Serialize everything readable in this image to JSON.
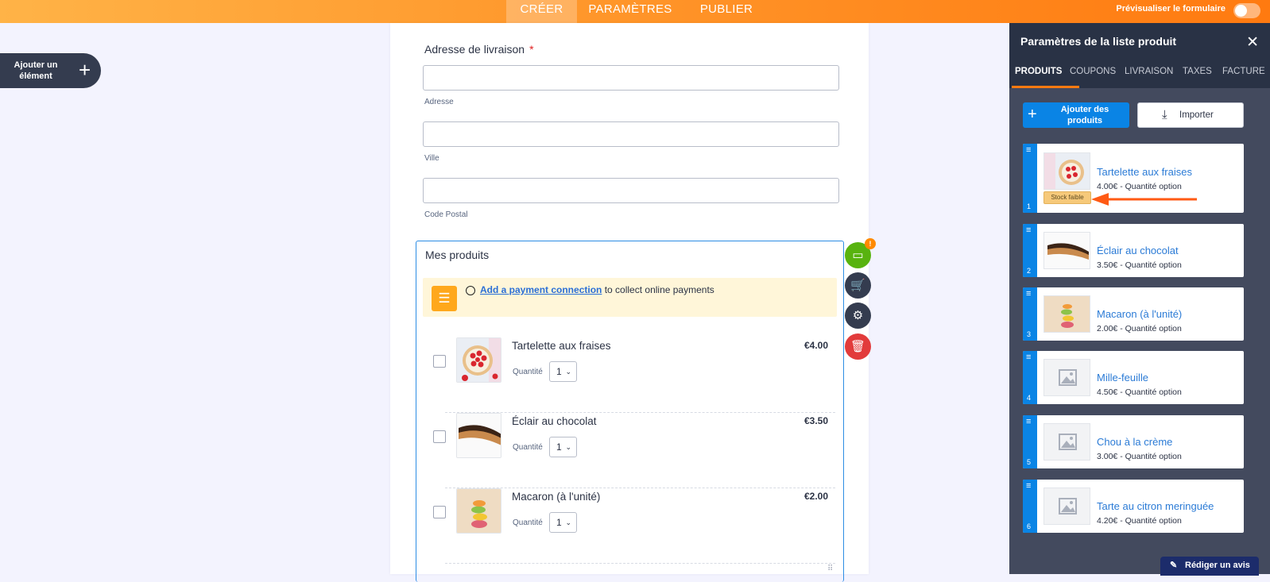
{
  "topbar": {
    "tabs": [
      {
        "label": "CRÉER",
        "active": true
      },
      {
        "label": "PARAMÈTRES",
        "active": false
      },
      {
        "label": "PUBLIER",
        "active": false
      }
    ],
    "preview_label": "Prévisualiser le formulaire"
  },
  "add_element": {
    "label": "Ajouter un élément"
  },
  "form": {
    "address_label": "Adresse de livraison",
    "required_mark": "*",
    "sub_address": "Adresse",
    "sub_city": "Ville",
    "sub_zip": "Code Postal",
    "products_title": "Mes produits",
    "payment_link": "Add a payment connection",
    "payment_text": "to collect online payments",
    "qty_label": "Quantité",
    "products": [
      {
        "name": "Tartelette aux fraises",
        "price": "€4.00",
        "qty": "1"
      },
      {
        "name": "Éclair au chocolat",
        "price": "€3.50",
        "qty": "1"
      },
      {
        "name": "Macaron (à l'unité)",
        "price": "€2.00",
        "qty": "1"
      }
    ]
  },
  "side_tools": {
    "badge": "!"
  },
  "panel": {
    "title": "Paramètres de la liste produit",
    "tabs": [
      {
        "label": "PRODUITS",
        "active": true
      },
      {
        "label": "COUPONS",
        "active": false
      },
      {
        "label": "LIVRAISON",
        "active": false
      },
      {
        "label": "TAXES",
        "active": false
      },
      {
        "label": "FACTURE",
        "active": false
      }
    ],
    "add_products": "Ajouter des produits",
    "import": "Importer",
    "stock_badge": "Stock faible",
    "items": [
      {
        "num": "1",
        "name": "Tartelette aux fraises",
        "price": "4.00€ - Quantité option"
      },
      {
        "num": "2",
        "name": "Éclair au chocolat",
        "price": "3.50€ - Quantité option"
      },
      {
        "num": "3",
        "name": "Macaron (à l'unité)",
        "price": "2.00€ - Quantité option"
      },
      {
        "num": "4",
        "name": "Mille-feuille",
        "price": "4.50€ - Quantité option"
      },
      {
        "num": "5",
        "name": "Chou à la crème",
        "price": "3.00€ - Quantité option"
      },
      {
        "num": "6",
        "name": "Tarte au citron meringuée",
        "price": "4.20€ - Quantité option"
      }
    ]
  },
  "review": {
    "label": "Rédiger un avis"
  },
  "colors": {
    "accent": "#ff7a10",
    "link": "#2b7bd6",
    "panel": "#293245",
    "primary": "#0a84e5"
  }
}
